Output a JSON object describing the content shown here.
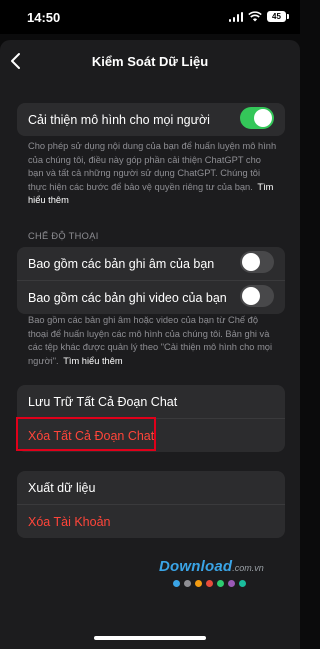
{
  "status_bar": {
    "time": "14:50",
    "battery": "45"
  },
  "header": {
    "title": "Kiểm Soát Dữ Liệu"
  },
  "improve_model": {
    "label": "Cải thiện mô hình cho mọi người",
    "enabled": true,
    "description": "Cho phép sử dụng nội dung của bạn để huấn luyện mô hình của chúng tôi, điều này góp phần cải thiện ChatGPT cho bạn và tất cả những người sử dụng ChatGPT. Chúng tôi thực hiện các bước để bảo vệ quyền riêng tư của bạn.",
    "learn_more": "Tìm hiểu thêm"
  },
  "voice_mode": {
    "section_title": "CHẾ ĐỘ THOẠI",
    "include_audio": {
      "label": "Bao gồm các bản ghi âm của bạn",
      "enabled": false
    },
    "include_video": {
      "label": "Bao gồm các bản ghi video của bạn",
      "enabled": false
    },
    "description": "Bao gồm các bản ghi âm hoặc video của bạn từ Chế độ thoại để huấn luyện các mô hình của chúng tôi. Bản ghi và các tệp khác được quản lý theo \"Cải thiện mô hình cho mọi người\".",
    "learn_more": "Tìm hiểu thêm"
  },
  "chats": {
    "archive_all": "Lưu Trữ Tất Cả Đoạn Chat",
    "delete_all": "Xóa Tất Cả Đoạn Chat"
  },
  "account": {
    "export_data": "Xuất dữ liệu",
    "delete_account": "Xóa Tài Khoản"
  },
  "watermark": {
    "text": "Download",
    "domain": ".com.vn",
    "dot_colors": [
      "#3aa4e6",
      "#8e8e93",
      "#f39c12",
      "#e74c3c",
      "#2ecc71",
      "#9b59b6",
      "#1abc9c"
    ]
  },
  "colors": {
    "toggle_on": "#34c759",
    "danger": "#ff453a",
    "highlight_border": "#e0001a"
  }
}
